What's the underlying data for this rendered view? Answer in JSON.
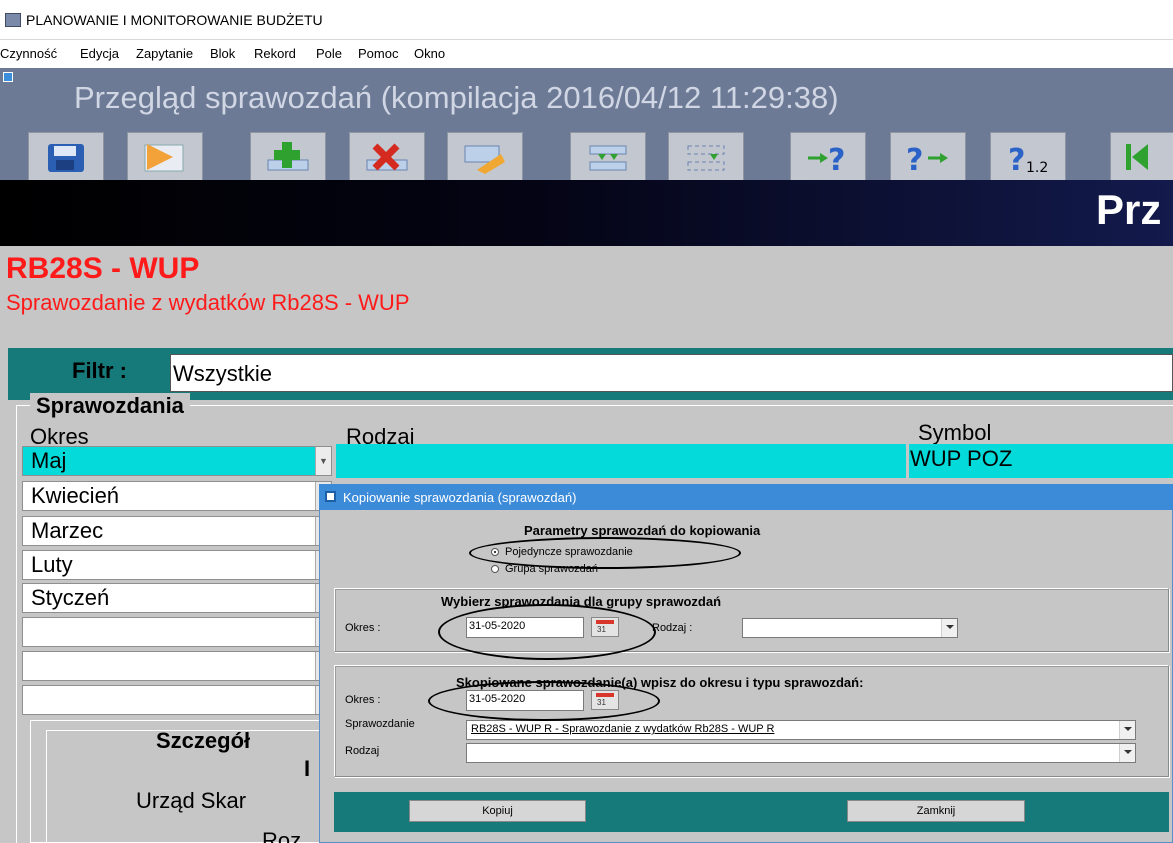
{
  "window": {
    "title": "PLANOWANIE I MONITOROWANIE BUDŻETU"
  },
  "menu": [
    "Czynność",
    "Edycja",
    "Zapytanie",
    "Blok",
    "Rekord",
    "Pole",
    "Pomoc",
    "Okno"
  ],
  "header": {
    "form_title": "Przegląd sprawozdań (kompilacja 2016/04/12 11:29:38)"
  },
  "toolbar": {
    "buttons": [
      "save-icon",
      "exit-icon",
      "insert-record-icon",
      "delete-record-icon",
      "clear-record-icon",
      "duplicate-record-icon",
      "clear-block-icon",
      "enter-query-icon",
      "execute-query-icon",
      "count-query-icon",
      "first-record-icon"
    ],
    "count_icon_text": "1.2"
  },
  "banner": {
    "text": "Prz"
  },
  "report": {
    "code": "RB28S - WUP",
    "description": "Sprawozdanie z wydatków Rb28S - WUP"
  },
  "filter": {
    "label": "Filtr :",
    "value": "Wszystkie"
  },
  "reports_group": {
    "label": "Sprawozdania",
    "columns": {
      "okres": "Okres",
      "rodzaj": "Rodzaj",
      "symbol": "Symbol"
    },
    "rows": [
      {
        "okres": "Maj",
        "symbol": "WUP POZ"
      },
      {
        "okres": "Kwiecień"
      },
      {
        "okres": "Marzec"
      },
      {
        "okres": "Luty"
      },
      {
        "okres": "Styczeń"
      },
      {
        "okres": ""
      },
      {
        "okres": ""
      },
      {
        "okres": ""
      }
    ]
  },
  "details": {
    "title": "Szczegół",
    "line2": "I",
    "office": "Urząd Skar",
    "roz": "Roz"
  },
  "dialog": {
    "title": "Kopiowanie sprawozdania (sprawozdań)",
    "params_title": "Parametry sprawozdań do kopiowania",
    "radio_single": "Pojedyncze sprawozdanie",
    "radio_group": "Grupa sprawozdań",
    "radio_selected": "single",
    "select_group": {
      "title": "Wybierz sprawozdania dla grupy sprawozdań",
      "okres_label": "Okres :",
      "okres_value": "31-05-2020",
      "rodzaj_label": "Rodzaj :",
      "rodzaj_value": ""
    },
    "target_group": {
      "title": "Skopiowane sprawozdanie(a) wpisz do okresu i typu sprawozdań:",
      "okres_label": "Okres :",
      "okres_value": "31-05-2020",
      "sprawozdanie_label": "Sprawozdanie",
      "sprawozdanie_value": "RB28S - WUP R - Sprawozdanie z wydatków Rb28S - WUP R",
      "rodzaj_label": "Rodzaj",
      "rodzaj_value": ""
    },
    "calendar_day": "31",
    "copy_button": "Kopiuj",
    "close_button": "Zamknij"
  },
  "colors": {
    "header_bg": "#6d7a96",
    "main_bg": "#c6c6c6",
    "accent_red": "#ff1a1a",
    "teal": "#177a7a",
    "selection_cyan": "#05dada",
    "dialog_title": "#3c8bd9"
  }
}
